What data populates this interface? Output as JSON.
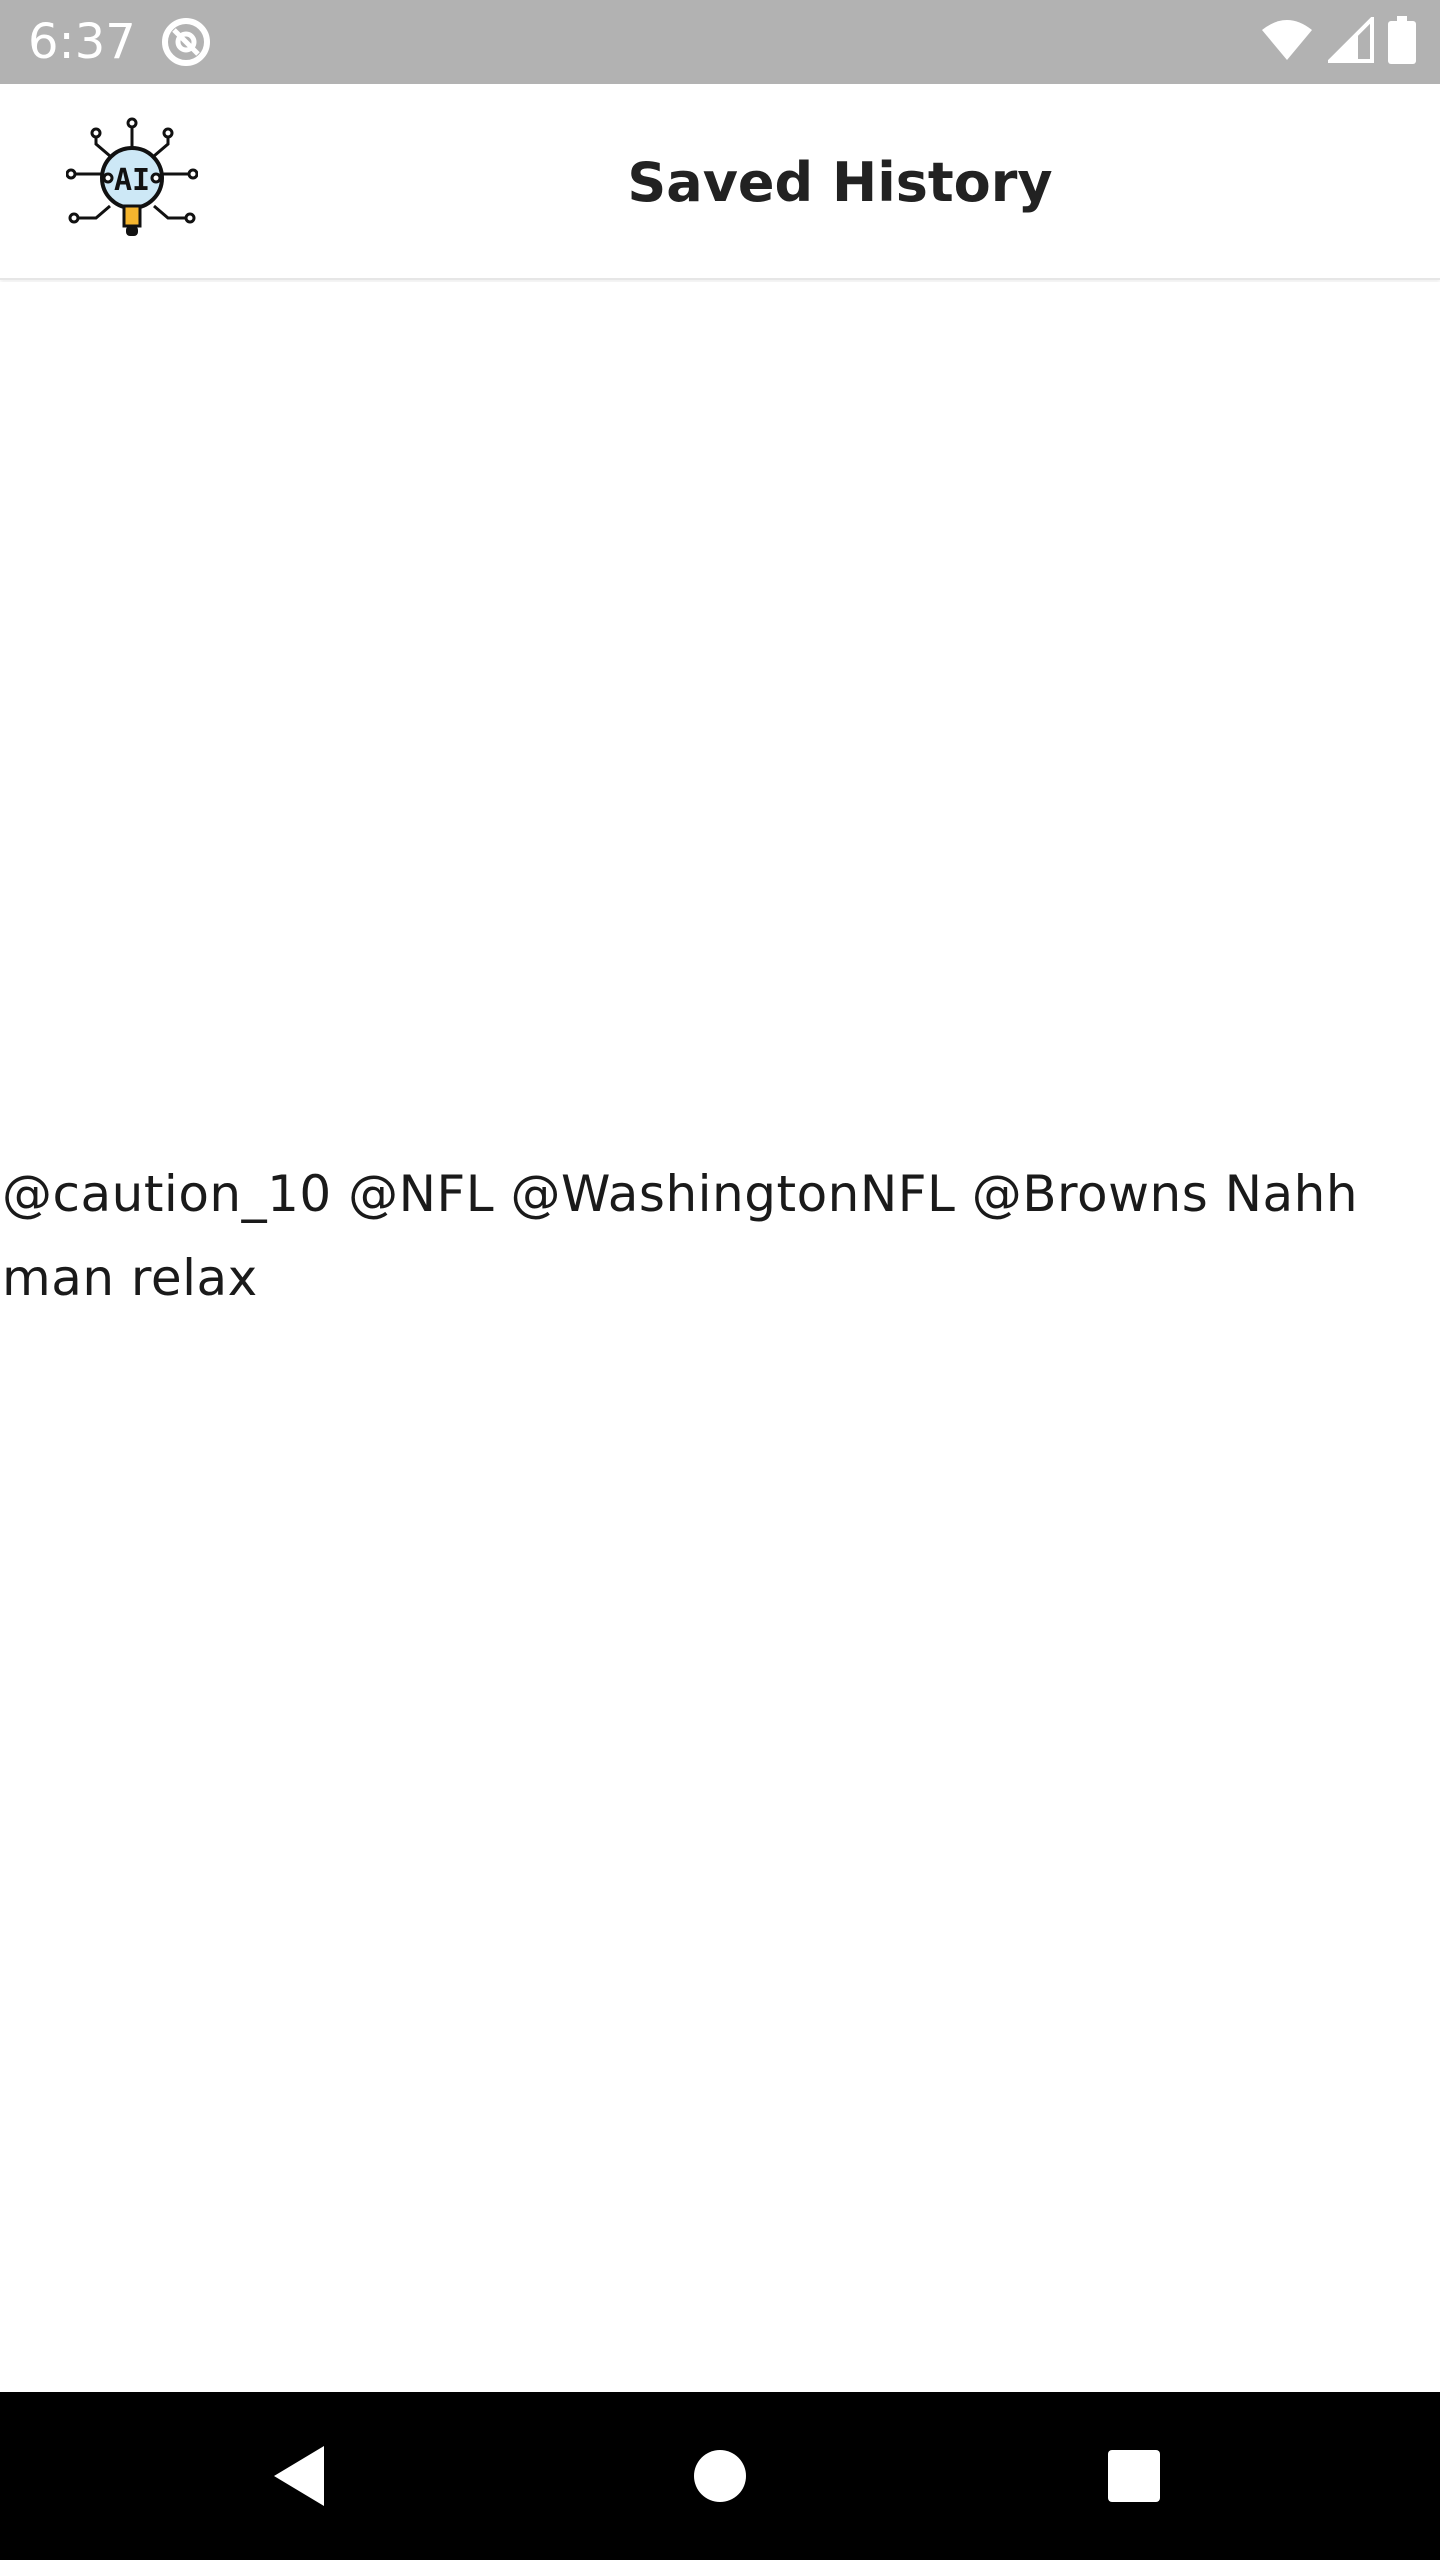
{
  "status_bar": {
    "time": "6:37",
    "icons": [
      "at-sign-icon",
      "wifi-icon",
      "cellular-signal-icon",
      "battery-icon"
    ]
  },
  "app_bar": {
    "logo": "ai-circuit-logo",
    "logo_text": "AI",
    "title": "Saved History"
  },
  "saved_items": [
    {
      "text": "@caution_10 @NFL @WashingtonNFL @Browns Nahh man relax"
    }
  ],
  "nav_bar": {
    "icons": [
      "back-icon",
      "home-icon",
      "recents-icon"
    ]
  },
  "colors": {
    "status_bar_bg": "#b2b2b2",
    "app_bar_bg": "#ffffff",
    "nav_bar_bg": "#000000",
    "logo_accent": "#cde8f6",
    "logo_highlight": "#f5b52e"
  }
}
